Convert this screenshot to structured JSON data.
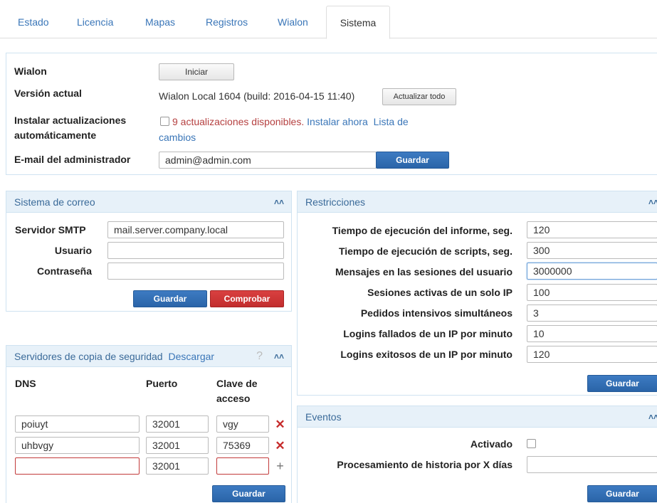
{
  "tabs": [
    "Estado",
    "Licencia",
    "Mapas",
    "Registros",
    "Wialon",
    "Sistema"
  ],
  "top": {
    "wialon_label": "Wialon",
    "start_button": "Iniciar",
    "version_label": "Versión actual",
    "version_value": "Wialon Local 1604 (build: 2016-04-15 11:40)",
    "update_all_button": "Actualizar todo",
    "auto_update_label_1": "Instalar actualizaciones",
    "auto_update_label_2": "automáticamente",
    "updates_available": "9 actualizaciones disponibles.",
    "install_now": "Instalar ahora",
    "changes_list_1": "Lista de",
    "changes_list_2": "cambios",
    "admin_email_label": "E-mail del administrador",
    "admin_email_value": "admin@admin.com",
    "save_button": "Guardar"
  },
  "mail": {
    "title": "Sistema de correo",
    "smtp_label": "Servidor SMTP",
    "smtp_value": "mail.server.company.local",
    "user_label": "Usuario",
    "user_value": "",
    "password_label": "Contraseña",
    "password_value": "",
    "save_button": "Guardar",
    "check_button": "Comprobar"
  },
  "backup": {
    "title": "Servidores de copia de seguridad",
    "download_link": "Descargar",
    "help": "?",
    "col_dns": "DNS",
    "col_port": "Puerto",
    "col_key_1": "Clave de",
    "col_key_2": "acceso",
    "rows": [
      {
        "dns": "poiuyt",
        "port": "32001",
        "key": "vgy"
      },
      {
        "dns": "uhbvgy",
        "port": "32001",
        "key": "75369"
      },
      {
        "dns": "",
        "port": "32001",
        "key": ""
      }
    ],
    "save_button": "Guardar"
  },
  "restrictions": {
    "title": "Restricciones",
    "items": [
      {
        "label": "Tiempo de ejecución del informe, seg.",
        "value": "120"
      },
      {
        "label": "Tiempo de ejecución de scripts, seg.",
        "value": "300"
      },
      {
        "label": "Mensajes en las sesiones del usuario",
        "value": "3000000"
      },
      {
        "label": "Sesiones activas de un solo IP",
        "value": "100"
      },
      {
        "label": "Pedidos intensivos simultáneos",
        "value": "3"
      },
      {
        "label": "Logins fallados de un IP por minuto",
        "value": "10"
      },
      {
        "label": "Logins exitosos de un IP por minuto",
        "value": "120"
      }
    ],
    "save_button": "Guardar"
  },
  "events": {
    "title": "Eventos",
    "enabled_label": "Activado",
    "history_label": "Procesamiento de historia por X días",
    "history_value": "",
    "save_button": "Guardar"
  },
  "colors": {
    "accent": "#2a64a8",
    "link": "#3a76b8",
    "danger": "#c22d2d",
    "panel_header": "#e7f1f9"
  }
}
